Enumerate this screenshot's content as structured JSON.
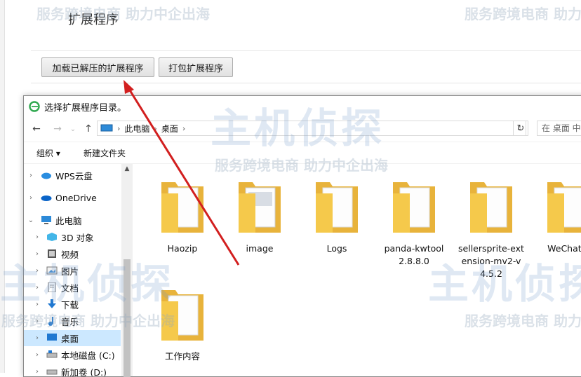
{
  "page": {
    "title": "扩展程序",
    "load_unpacked_label": "加载已解压的扩展程序",
    "pack_label": "打包扩展程序"
  },
  "dialog": {
    "title": "选择扩展程序目录。",
    "address": {
      "crumbs": [
        "此电脑",
        "桌面"
      ]
    },
    "search_placeholder": "在 桌面 中",
    "toolbar": {
      "organize": "组织 ▾",
      "new_folder": "新建文件夹"
    },
    "sidebar": [
      {
        "label": "WPS云盘",
        "icon": "cloud-icon"
      },
      {
        "label": "OneDrive",
        "icon": "onedrive-icon"
      },
      {
        "label": "此电脑",
        "icon": "pc-icon"
      },
      {
        "label": "3D 对象",
        "icon": "3d-objects-icon"
      },
      {
        "label": "视频",
        "icon": "video-icon"
      },
      {
        "label": "图片",
        "icon": "pictures-icon"
      },
      {
        "label": "文档",
        "icon": "documents-icon"
      },
      {
        "label": "下载",
        "icon": "download-icon"
      },
      {
        "label": "音乐",
        "icon": "music-icon"
      },
      {
        "label": "桌面",
        "icon": "desktop-icon",
        "selected": true
      },
      {
        "label": "本地磁盘 (C:)",
        "icon": "drive-icon"
      },
      {
        "label": "新加卷 (D:)",
        "icon": "drive-icon"
      }
    ],
    "files": [
      {
        "name": "Haozip"
      },
      {
        "name": "image"
      },
      {
        "name": "Logs"
      },
      {
        "name": "panda-kwtool 2.8.8.0"
      },
      {
        "name": "sellersprite-ext ension-mv2-v 4.5.2"
      },
      {
        "name": "WeChat F"
      },
      {
        "name": "工作内容"
      }
    ]
  },
  "watermark": {
    "text": "服务跨境电商 助力中企出海",
    "logo": "主机侦探"
  },
  "colors": {
    "selection": "#cce8ff",
    "folder": "#f5c94b",
    "arrow": "#d21f1f"
  }
}
